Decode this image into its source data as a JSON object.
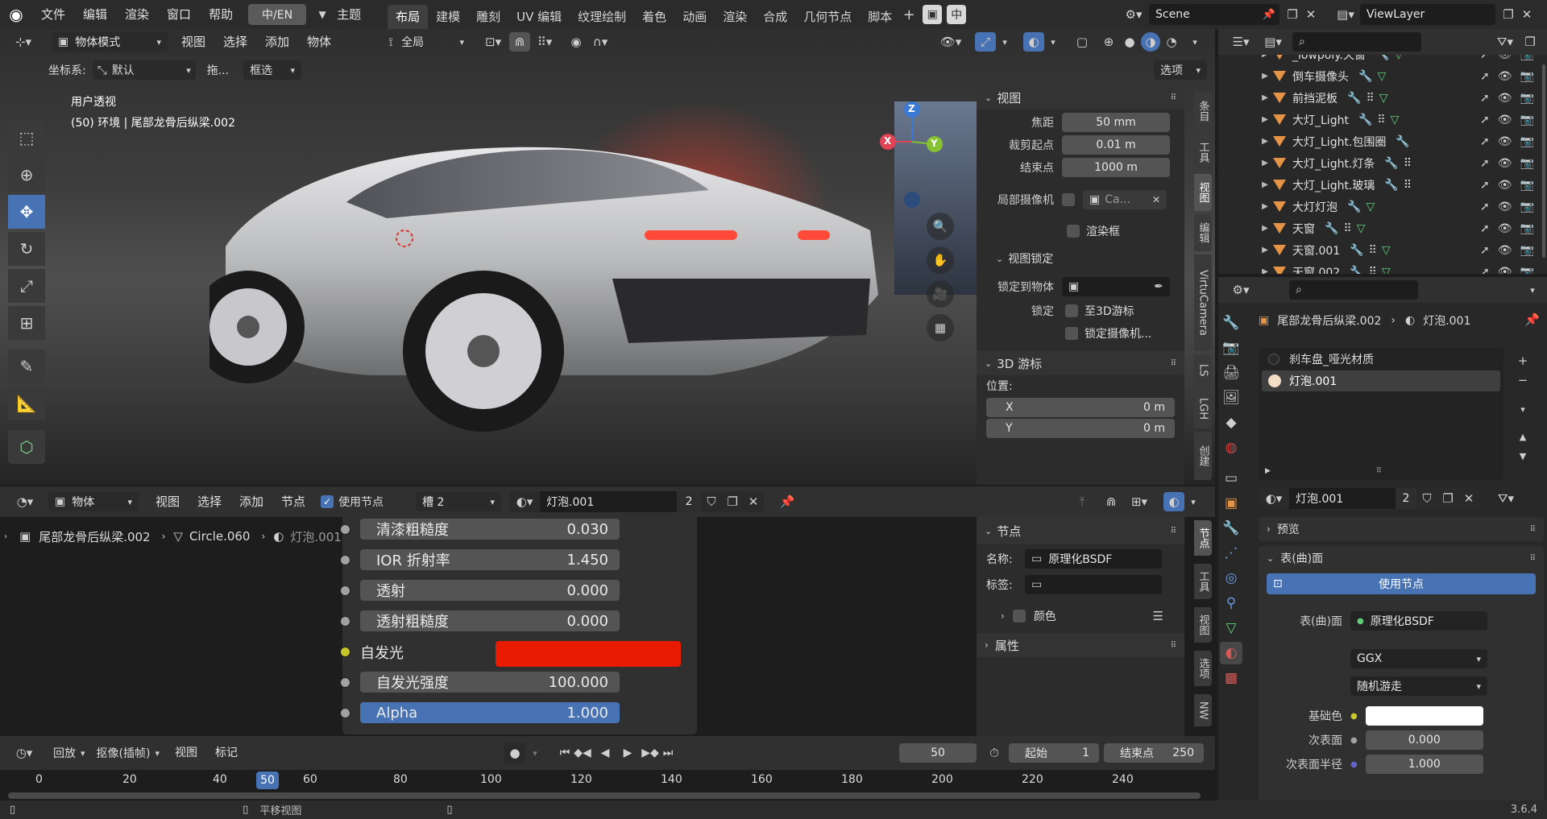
{
  "topbar": {
    "menus": [
      "文件",
      "编辑",
      "渲染",
      "窗口",
      "帮助"
    ],
    "lang_toggle": "中/EN",
    "theme": "主题",
    "workspaces": [
      "布局",
      "建模",
      "雕刻",
      "UV 编辑",
      "纹理绘制",
      "着色",
      "动画",
      "渲染",
      "合成",
      "几何节点",
      "脚本"
    ],
    "active_workspace": "布局",
    "ime": "中",
    "scene_name": "Scene",
    "view_layer": "ViewLayer"
  },
  "viewport": {
    "mode": "物体模式",
    "menus": [
      "视图",
      "选择",
      "添加",
      "物体"
    ],
    "transform_orientation": "全局",
    "coord_label": "坐标系:",
    "coord_value": "默认",
    "drag_label": "拖...",
    "drag_value": "框选",
    "options": "选项",
    "view_name": "用户透视",
    "info_line": "(50) 环境 | 尾部龙骨后纵梁.002",
    "gizmo": {
      "x": "X",
      "y": "Y",
      "z": "Z"
    }
  },
  "npanel": {
    "view_header": "视图",
    "focal_label": "焦距",
    "focal_value": "50 mm",
    "clip_start_label": "裁剪起点",
    "clip_start_value": "0.01 m",
    "clip_end_label": "结束点",
    "clip_end_value": "1000 m",
    "local_camera_label": "局部摄像机",
    "local_camera_value": "Ca...",
    "render_border": "渲染框",
    "view_lock_header": "视图锁定",
    "lock_to_object_label": "锁定到物体",
    "lock_label": "锁定",
    "lock_3d_cursor": "至3D游标",
    "lock_camera": "锁定摄像机...",
    "cursor_header": "3D 游标",
    "location_label": "位置:",
    "x_label": "X",
    "x_value": "0 m",
    "y_label": "Y",
    "y_value": "0 m",
    "tabs": [
      "条目",
      "工具",
      "视图",
      "编辑",
      "VirtuCamera",
      "LS",
      "LGH",
      "创建"
    ]
  },
  "outliner": {
    "items": [
      {
        "name": "_lowpoly.天窗",
        "modifier": true,
        "constraint": false,
        "mesh": true
      },
      {
        "name": "倒车摄像头",
        "modifier": true,
        "constraint": false,
        "mesh": true
      },
      {
        "name": "前挡泥板",
        "modifier": true,
        "constraint": true,
        "mesh": true
      },
      {
        "name": "大灯_Light",
        "modifier": true,
        "constraint": true,
        "mesh": true
      },
      {
        "name": "大灯_Light.包围圈",
        "modifier": true,
        "constraint": false,
        "mesh": false
      },
      {
        "name": "大灯_Light.灯条",
        "modifier": true,
        "constraint": true,
        "mesh": false
      },
      {
        "name": "大灯_Light.玻璃",
        "modifier": true,
        "constraint": true,
        "mesh": false
      },
      {
        "name": "大灯灯泡",
        "modifier": true,
        "constraint": false,
        "mesh": true
      },
      {
        "name": "天窗",
        "modifier": true,
        "constraint": true,
        "mesh": true
      },
      {
        "name": "天窗.001",
        "modifier": true,
        "constraint": true,
        "mesh": true
      },
      {
        "name": "天窗.002",
        "modifier": true,
        "constraint": true,
        "mesh": true
      }
    ]
  },
  "node_editor": {
    "type": "物体",
    "menus": [
      "视图",
      "选择",
      "添加",
      "节点"
    ],
    "use_nodes": "使用节点",
    "slot": "槽 2",
    "material": "灯泡.001",
    "users": "2",
    "breadcrumb": [
      "尾部龙骨后纵梁.002",
      "Circle.060",
      "灯泡.001"
    ],
    "rows": [
      {
        "label": "清漆粗糙度",
        "value": "0.030",
        "type": "field"
      },
      {
        "label": "IOR 折射率",
        "value": "1.450",
        "type": "field"
      },
      {
        "label": "透射",
        "value": "0.000",
        "type": "field"
      },
      {
        "label": "透射粗糙度",
        "value": "0.000",
        "type": "field"
      },
      {
        "label": "自发光",
        "value": "",
        "type": "color",
        "color": "#e81a00"
      },
      {
        "label": "自发光强度",
        "value": "100.000",
        "type": "field"
      },
      {
        "label": "Alpha",
        "value": "1.000",
        "type": "selected"
      }
    ],
    "side": {
      "node_header": "节点",
      "name_label": "名称:",
      "name_value": "原理化BSDF",
      "label_label": "标签:",
      "color_label": "颜色",
      "properties_header": "属性",
      "tabs": [
        "节点",
        "工具",
        "视图",
        "选项",
        "NW"
      ]
    }
  },
  "properties": {
    "breadcrumb_obj": "尾部龙骨后纵梁.002",
    "breadcrumb_mat": "灯泡.001",
    "slots": [
      "刹车盘_哑光材质",
      "灯泡.001"
    ],
    "material": "灯泡.001",
    "users": "2",
    "preview": "预览",
    "surface_header": "表(曲)面",
    "use_nodes": "使用节点",
    "surface_label": "表(曲)面",
    "surface_value": "原理化BSDF",
    "distribution": "GGX",
    "subsurface_method": "随机游走",
    "base_color_label": "基础色",
    "subsurface_label": "次表面",
    "subsurface_value": "0.000",
    "subsurface_radius_label": "次表面半径",
    "subsurface_radius_value": "1.000"
  },
  "timeline": {
    "playback": "回放",
    "keying": "抠像(插帧)",
    "menus": [
      "视图",
      "标记"
    ],
    "current_frame": "50",
    "start_label": "起始",
    "start_value": "1",
    "end_label": "结束点",
    "end_value": "250",
    "ticks": [
      "0",
      "20",
      "40",
      "50",
      "60",
      "80",
      "100",
      "120",
      "140",
      "160",
      "180",
      "200",
      "220",
      "240"
    ]
  },
  "statusbar": {
    "pan_view": "平移视图",
    "version": "3.6.4"
  },
  "colors": {
    "accent": "#4772b3",
    "emission": "#e81a00",
    "object_orange": "#e59344",
    "mesh_green": "#5fd07a",
    "modifier_blue": "#6a9ae0"
  }
}
